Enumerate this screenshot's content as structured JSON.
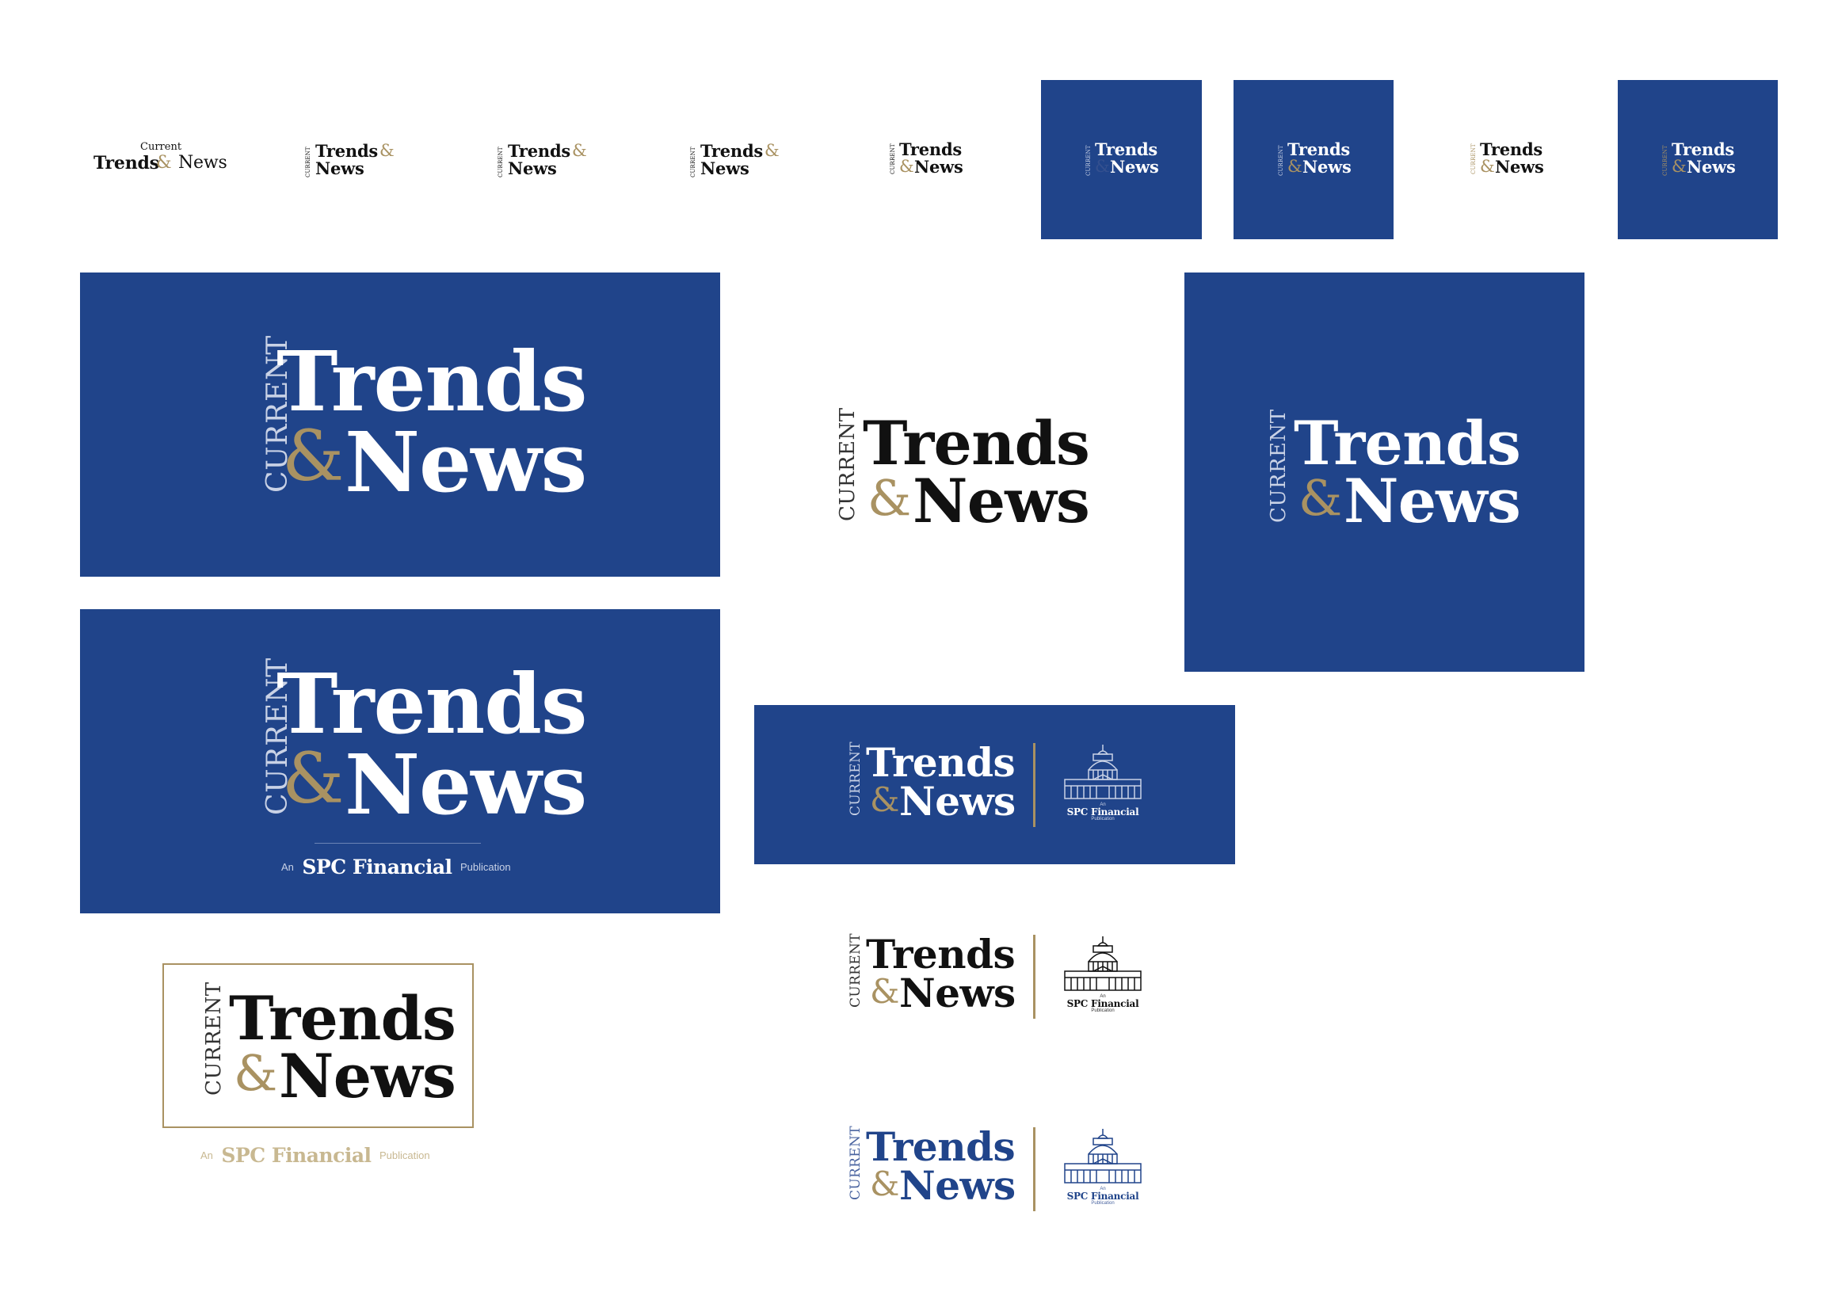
{
  "logo": {
    "current": "Current",
    "current_caps": "CURRENT",
    "trends": "Trends",
    "amp": "&",
    "news": "News"
  },
  "publication": {
    "an": "An",
    "brand": "SPC Financial",
    "suffix": "Publication"
  },
  "colors": {
    "navy": "#20448a",
    "gold": "#a99262",
    "black": "#111111",
    "white": "#ffffff"
  },
  "icons": [
    "capitol-building-icon"
  ]
}
